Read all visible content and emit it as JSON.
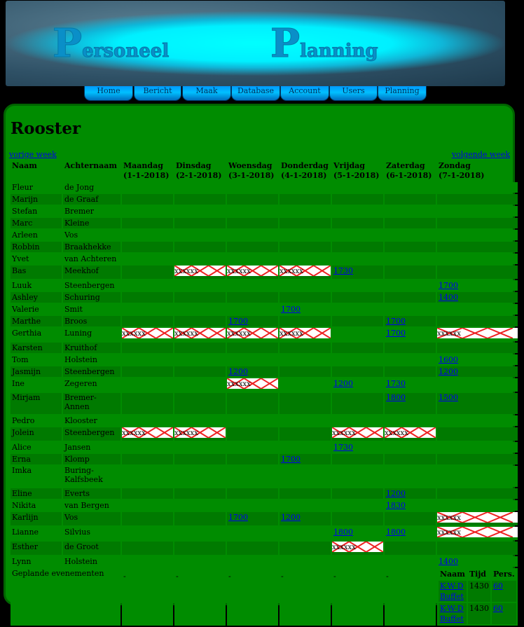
{
  "banner": {
    "title_word1": "Personeel",
    "title_word2": "Planning"
  },
  "nav": [
    "Home",
    "Bericht",
    "Maak",
    "Database",
    "Account",
    "Users",
    "Planning"
  ],
  "page_title": "Rooster",
  "week_nav": {
    "prev": "vorige week",
    "next": "volgende week"
  },
  "table": {
    "headers": [
      {
        "l1": "Naam",
        "l2": ""
      },
      {
        "l1": "Achternaam",
        "l2": ""
      },
      {
        "l1": "Maandag",
        "l2": "(1-1-2018)"
      },
      {
        "l1": "Dinsdag",
        "l2": "(2-1-2018)"
      },
      {
        "l1": "Woensdag",
        "l2": "(3-1-2018)"
      },
      {
        "l1": "Donderdag",
        "l2": "(4-1-2018)"
      },
      {
        "l1": "Vrijdag",
        "l2": "(5-1-2018)"
      },
      {
        "l1": "Zaterdag",
        "l2": "(6-1-2018)"
      },
      {
        "l1": "Zondag",
        "l2": "(7-1-2018)"
      }
    ],
    "x_label": "xxxxxx",
    "rows": [
      {
        "first": "Fleur",
        "last": "de Jong",
        "days": [
          "",
          "",
          "",
          "",
          "",
          "",
          ""
        ]
      },
      {
        "first": "Marijn",
        "last": "de Graaf",
        "days": [
          "",
          "",
          "",
          "",
          "",
          "",
          ""
        ]
      },
      {
        "first": "Stefan",
        "last": "Bremer",
        "days": [
          "",
          "",
          "",
          "",
          "",
          "",
          ""
        ]
      },
      {
        "first": "Marc",
        "last": "Kleine",
        "days": [
          "",
          "",
          "",
          "",
          "",
          "",
          ""
        ]
      },
      {
        "first": "Arleen",
        "last": "Vos",
        "days": [
          "",
          "",
          "",
          "",
          "",
          "",
          ""
        ]
      },
      {
        "first": "Robbin",
        "last": "Braakhekke",
        "days": [
          "",
          "",
          "",
          "",
          "",
          "",
          ""
        ]
      },
      {
        "first": "Yvet",
        "last": "van Achteren",
        "days": [
          "",
          "",
          "",
          "",
          "",
          "",
          ""
        ]
      },
      {
        "first": "Bas",
        "last": "Meekhof",
        "days": [
          "",
          "X",
          "X",
          "X",
          "1730",
          "",
          ""
        ]
      },
      {
        "first": "Luuk",
        "last": "Steenbergen",
        "days": [
          "",
          "",
          "",
          "",
          "",
          "",
          "1700"
        ]
      },
      {
        "first": "Ashley",
        "last": "Schuring",
        "days": [
          "",
          "",
          "",
          "",
          "",
          "",
          "1400"
        ]
      },
      {
        "first": "Valerie",
        "last": "Smit",
        "days": [
          "",
          "",
          "",
          "1700",
          "",
          "",
          ""
        ]
      },
      {
        "first": "Marthe",
        "last": "Broos",
        "days": [
          "",
          "",
          "1700",
          "",
          "",
          "1700",
          ""
        ]
      },
      {
        "first": "Gerthia",
        "last": "Luning",
        "days": [
          "X",
          "X",
          "X",
          "X",
          "",
          "1700",
          "X"
        ]
      },
      {
        "first": "Karsten",
        "last": "Kruithof",
        "days": [
          "",
          "",
          "",
          "",
          "",
          "",
          ""
        ]
      },
      {
        "first": "Tom",
        "last": "Holstein",
        "days": [
          "",
          "",
          "",
          "",
          "",
          "",
          "1600"
        ]
      },
      {
        "first": "Jasmijn",
        "last": "Steenbergen",
        "days": [
          "",
          "",
          "1200",
          "",
          "",
          "",
          "1200"
        ]
      },
      {
        "first": "Ine",
        "last": "Zegeren",
        "days": [
          "",
          "",
          "X",
          "",
          "1200",
          "1730",
          ""
        ]
      },
      {
        "first": "Mirjam",
        "last": "Bremer-Annen",
        "days": [
          "",
          "",
          "",
          "",
          "",
          "1800",
          "1500"
        ],
        "tall": true
      },
      {
        "first": "Pedro",
        "last": "Klooster",
        "days": [
          "",
          "",
          "",
          "",
          "",
          "",
          ""
        ]
      },
      {
        "first": "Jolein",
        "last": "Steenbergen",
        "days": [
          "X",
          "X",
          "",
          "",
          "X",
          "X",
          ""
        ]
      },
      {
        "first": "Alice",
        "last": "Jansen",
        "days": [
          "",
          "",
          "",
          "",
          "1730",
          "",
          ""
        ]
      },
      {
        "first": "Erna",
        "last": "Klomp",
        "days": [
          "",
          "",
          "",
          "1700",
          "",
          "",
          ""
        ]
      },
      {
        "first": "Imka",
        "last": "Buring-Kalfsbeek",
        "days": [
          "",
          "",
          "",
          "",
          "",
          "",
          ""
        ],
        "tall": true
      },
      {
        "first": "Eline",
        "last": "Everts",
        "days": [
          "",
          "",
          "",
          "",
          "",
          "1200",
          ""
        ]
      },
      {
        "first": "Nikita",
        "last": "van Bergen",
        "days": [
          "",
          "",
          "",
          "",
          "",
          "1830",
          ""
        ]
      },
      {
        "first": "Karlijn",
        "last": "Vos",
        "days": [
          "",
          "",
          "1700",
          "1200",
          "",
          "",
          "X"
        ]
      },
      {
        "first": "Lianne",
        "last": "Silvius",
        "days": [
          "",
          "",
          "",
          "",
          "1800",
          "1800",
          "X"
        ]
      },
      {
        "first": "Esther",
        "last": "de Groot",
        "days": [
          "",
          "",
          "",
          "",
          "X",
          "",
          ""
        ]
      },
      {
        "first": "Lynn",
        "last": "Holstein",
        "days": [
          "",
          "",
          "",
          "",
          "",
          "",
          "1400"
        ]
      }
    ],
    "events": {
      "label": "Geplande evenementen",
      "placeholders": [
        "-",
        "-",
        "-",
        "-",
        "-",
        "-"
      ],
      "headers": [
        "Naam",
        "Tijd",
        "Pers."
      ],
      "rows": [
        {
          "name": "K-W-D Buffet",
          "time": "1430",
          "pers": "60"
        },
        {
          "name": "K-W-D Buffet",
          "time": "1430",
          "pers": "60"
        }
      ]
    }
  }
}
